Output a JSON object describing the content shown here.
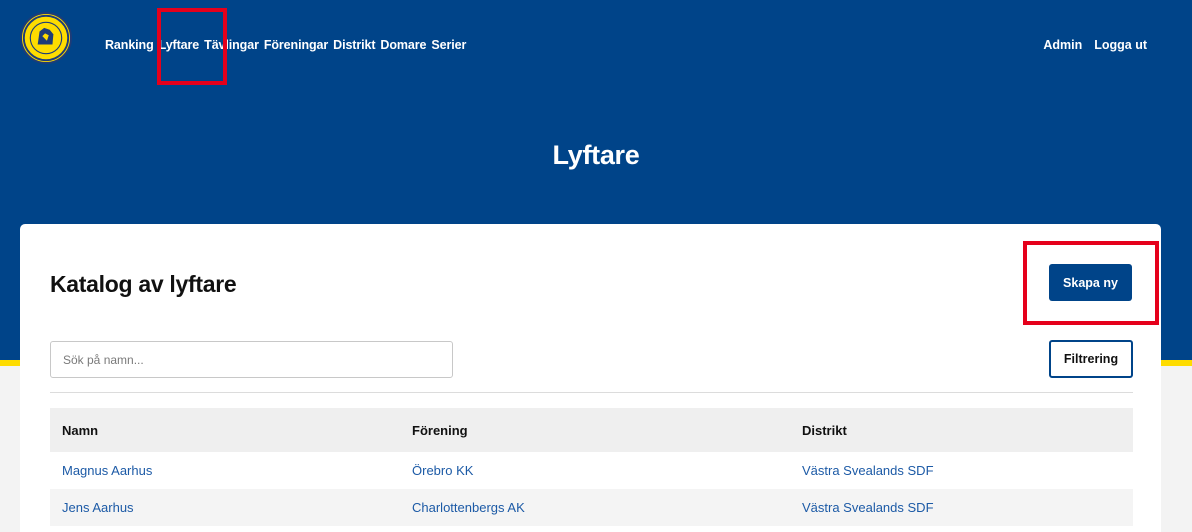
{
  "header": {
    "logo_icon": "federation-shield-icon",
    "nav": [
      "Ranking",
      "Lyftare",
      "Tävlingar",
      "Föreningar",
      "Distrikt",
      "Domare",
      "Serier"
    ],
    "nav_right": [
      "Admin",
      "Logga ut"
    ]
  },
  "hero": {
    "title": "Lyftare"
  },
  "catalog": {
    "title": "Katalog av lyftare",
    "create_label": "Skapa ny",
    "search_placeholder": "Sök på namn...",
    "filter_label": "Filtrering"
  },
  "table": {
    "columns": [
      "Namn",
      "Förening",
      "Distrikt"
    ],
    "rows": [
      [
        "Magnus Aarhus",
        "Örebro KK",
        "Västra Svealands SDF"
      ],
      [
        "Jens Aarhus",
        "Charlottenbergs AK",
        "Västra Svealands SDF"
      ]
    ]
  },
  "colors": {
    "primary": "#004489",
    "accent": "#fedc00",
    "highlight": "#e5001b",
    "link": "#1c5aa6"
  }
}
